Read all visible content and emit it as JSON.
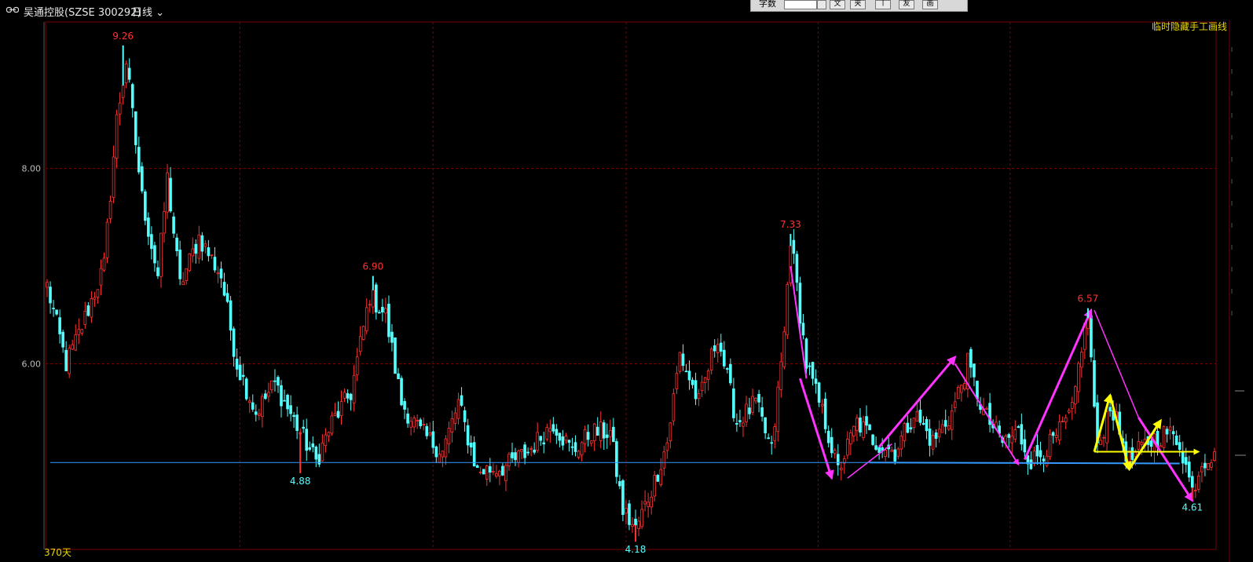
{
  "window": {
    "title": "吴通控股(SZSE 300292)",
    "period": "日线"
  },
  "toolbar": {
    "label": "字数",
    "buttons": [
      "文",
      "夹",
      "ㅣ",
      "友",
      "画"
    ]
  },
  "hide_lines_label": "临时隐藏手工画线",
  "days_label": "370天",
  "colors": {
    "up": "#ff3232",
    "down": "#54ffff",
    "grid": "#7a0000",
    "support": "#3399ff",
    "magenta": "#ff33ff",
    "yellow": "#ffff00",
    "label_high": "#ff3232",
    "label_low": "#54ffff",
    "text_yellow": "#e8d800"
  },
  "chart_data": {
    "type": "candlestick",
    "ylim": [
      4.1,
      9.5
    ],
    "yticks": [
      {
        "value": 8.0,
        "label": "8.00"
      },
      {
        "value": 6.0,
        "label": "6.00"
      }
    ],
    "n": 370,
    "anchors": [
      [
        0,
        6.8
      ],
      [
        6,
        6.0
      ],
      [
        10,
        6.3
      ],
      [
        18,
        7.0
      ],
      [
        22,
        8.5
      ],
      [
        25,
        9.1
      ],
      [
        30,
        7.7
      ],
      [
        35,
        6.9
      ],
      [
        38,
        7.9
      ],
      [
        42,
        6.8
      ],
      [
        48,
        7.3
      ],
      [
        55,
        6.9
      ],
      [
        60,
        6.0
      ],
      [
        66,
        5.5
      ],
      [
        72,
        5.8
      ],
      [
        80,
        5.3
      ],
      [
        85,
        5.0
      ],
      [
        90,
        5.4
      ],
      [
        96,
        5.7
      ],
      [
        102,
        6.7
      ],
      [
        107,
        6.5
      ],
      [
        112,
        5.6
      ],
      [
        118,
        5.3
      ],
      [
        125,
        5.1
      ],
      [
        130,
        5.6
      ],
      [
        136,
        4.9
      ],
      [
        145,
        4.95
      ],
      [
        152,
        5.1
      ],
      [
        160,
        5.4
      ],
      [
        166,
        5.1
      ],
      [
        172,
        5.3
      ],
      [
        178,
        5.3
      ],
      [
        182,
        4.5
      ],
      [
        186,
        4.3
      ],
      [
        192,
        4.8
      ],
      [
        196,
        5.2
      ],
      [
        200,
        6.1
      ],
      [
        206,
        5.6
      ],
      [
        212,
        6.3
      ],
      [
        218,
        5.4
      ],
      [
        224,
        5.6
      ],
      [
        229,
        5.1
      ],
      [
        233,
        6.3
      ],
      [
        235,
        7.3
      ],
      [
        240,
        6.0
      ],
      [
        246,
        5.4
      ],
      [
        250,
        4.9
      ],
      [
        256,
        5.4
      ],
      [
        262,
        5.2
      ],
      [
        268,
        5.1
      ],
      [
        274,
        5.5
      ],
      [
        280,
        5.2
      ],
      [
        286,
        5.5
      ],
      [
        291,
        6.0
      ],
      [
        296,
        5.5
      ],
      [
        302,
        5.2
      ],
      [
        307,
        5.3
      ],
      [
        311,
        5.0
      ],
      [
        318,
        5.2
      ],
      [
        324,
        5.5
      ],
      [
        327,
        6.2
      ],
      [
        329,
        6.5
      ],
      [
        332,
        5.1
      ],
      [
        336,
        5.6
      ],
      [
        342,
        5.0
      ],
      [
        348,
        5.2
      ],
      [
        354,
        5.3
      ],
      [
        358,
        5.2
      ],
      [
        362,
        4.7
      ],
      [
        365,
        5.0
      ],
      [
        369,
        5.1
      ]
    ],
    "annotations": [
      {
        "label": "9.26",
        "idx": 24,
        "value": 9.26,
        "kind": "high"
      },
      {
        "label": "4.88",
        "idx": 80,
        "value": 4.88,
        "kind": "low"
      },
      {
        "label": "6.90",
        "idx": 103,
        "value": 6.9,
        "kind": "high"
      },
      {
        "label": "4.18",
        "idx": 186,
        "value": 4.18,
        "kind": "low"
      },
      {
        "label": "7.33",
        "idx": 235,
        "value": 7.33,
        "kind": "high"
      },
      {
        "label": "6.57",
        "idx": 329,
        "value": 6.57,
        "kind": "high"
      },
      {
        "label": "4.61",
        "idx": 362,
        "value": 4.61,
        "kind": "low"
      }
    ],
    "drawn_lines": [
      {
        "color": "support",
        "width": 2,
        "points": [
          [
            260,
            4.99
          ],
          [
            358,
            4.98
          ]
        ]
      },
      {
        "color": "magenta",
        "width": 3,
        "arrow": true,
        "points": [
          [
            238,
            5.85
          ],
          [
            248,
            4.83
          ]
        ]
      },
      {
        "color": "magenta",
        "width": 2,
        "arrow": false,
        "points": [
          [
            235,
            7.0
          ],
          [
            240,
            5.85
          ]
        ]
      },
      {
        "color": "magenta",
        "width": 1.5,
        "arrow": false,
        "points": [
          [
            253,
            4.83
          ],
          [
            267,
            5.18
          ]
        ]
      },
      {
        "color": "magenta",
        "width": 3,
        "arrow": true,
        "points": [
          [
            263,
            5.15
          ],
          [
            287,
            6.07
          ]
        ]
      },
      {
        "color": "magenta",
        "width": 2,
        "arrow": true,
        "points": [
          [
            287,
            6.0
          ],
          [
            307,
            4.97
          ]
        ]
      },
      {
        "color": "magenta",
        "width": 3,
        "arrow": true,
        "points": [
          [
            309,
            5.02
          ],
          [
            330,
            6.55
          ]
        ]
      },
      {
        "color": "magenta",
        "width": 1.5,
        "arrow": false,
        "points": [
          [
            331,
            6.55
          ],
          [
            345,
            5.45
          ]
        ]
      },
      {
        "color": "magenta",
        "width": 3,
        "arrow": true,
        "points": [
          [
            345,
            5.45
          ],
          [
            362,
            4.6
          ]
        ]
      },
      {
        "color": "yellow",
        "width": 3,
        "arrow": true,
        "points": [
          [
            331,
            5.1
          ],
          [
            336,
            5.68
          ]
        ]
      },
      {
        "color": "yellow",
        "width": 3,
        "arrow": true,
        "points": [
          [
            336,
            5.68
          ],
          [
            342,
            4.92
          ]
        ]
      },
      {
        "color": "yellow",
        "width": 3,
        "arrow": true,
        "points": [
          [
            342,
            4.92
          ],
          [
            352,
            5.42
          ]
        ]
      },
      {
        "color": "yellow",
        "width": 2,
        "arrow": true,
        "points": [
          [
            331,
            5.1
          ],
          [
            364,
            5.1
          ]
        ]
      }
    ]
  }
}
